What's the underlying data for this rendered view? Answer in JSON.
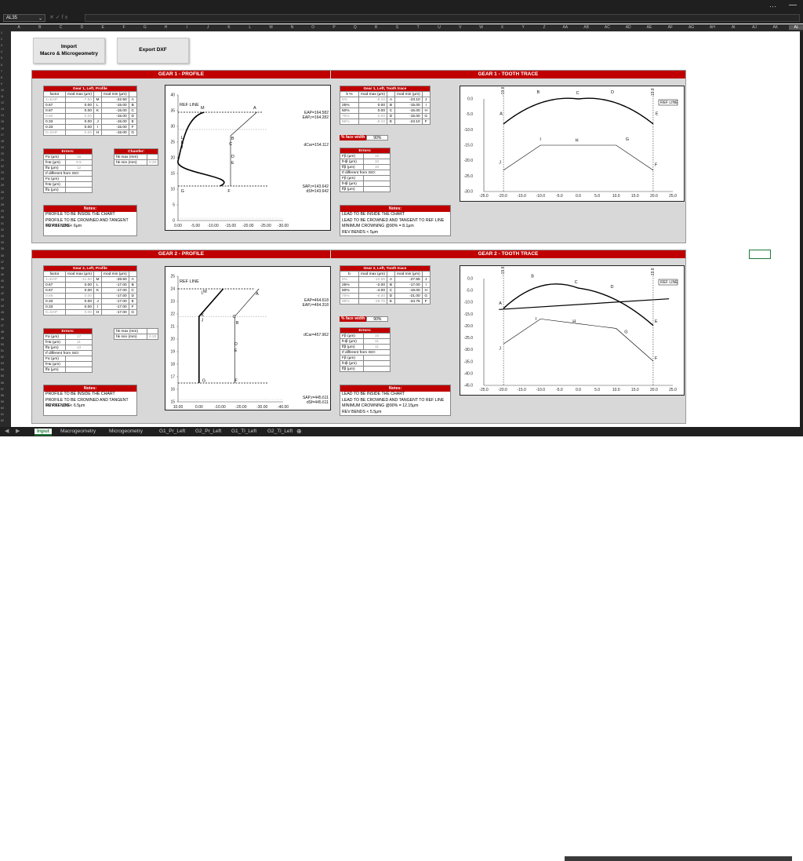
{
  "excel": {
    "name_box": "AL35",
    "title_dots": "···",
    "title_min": "—",
    "columns": [
      "A",
      "B",
      "C",
      "D",
      "E",
      "F",
      "G",
      "H",
      "I",
      "J",
      "K",
      "L",
      "M",
      "N",
      "O",
      "P",
      "Q",
      "R",
      "S",
      "T",
      "U",
      "V",
      "W",
      "X",
      "Y",
      "Z",
      "AA",
      "AB",
      "AC",
      "AD",
      "AE",
      "AF",
      "AG",
      "AH",
      "AI",
      "AJ",
      "AK",
      "AL",
      "AM"
    ],
    "tabs": [
      "Input",
      "Macrogeometry",
      "Microgeometry",
      "G1_Pr_Left",
      "G2_Pr_Left",
      "G1_Tl_Left",
      "G2_Tl_Left"
    ],
    "active_tab": "Input",
    "tab_add": "⊕"
  },
  "buttons": {
    "import": "Import\nMacro & Microgeometry",
    "export": "Export DXF"
  },
  "gear1": {
    "profile_title": "GEAR 1 - PROFILE",
    "trace_title": "GEAR 1 - TOOTH TRACE",
    "profile_table": {
      "title": "Gear 1, Left, Profile",
      "headers": [
        "factor",
        "mod max (μm)",
        "",
        "mod min (μm)",
        ""
      ],
      "rows": [
        [
          "1=EAP",
          "-7.50",
          "M",
          "-22.50",
          "A"
        ],
        [
          "0.67",
          "0.00",
          "L",
          "-15.00",
          "B"
        ],
        [
          "0.67",
          "0.00",
          "K",
          "-15.00",
          "C"
        ],
        [
          "0.60",
          "0.00",
          "",
          "-15.00",
          "D"
        ],
        [
          "0.33",
          "0.00",
          "J",
          "-15.00",
          "E"
        ],
        [
          "0.33",
          "0.00",
          "I",
          "-15.00",
          "F"
        ],
        [
          "0=SAP",
          "0.00",
          "H",
          "-15.00",
          "G"
        ]
      ]
    },
    "errors": {
      "title": "Errors:",
      "rows": [
        [
          "Fα (μm)",
          "15"
        ],
        [
          "fHα (μm)",
          "9.5"
        ],
        [
          "ffα (μm)",
          "12"
        ]
      ],
      "iso": "If different from ISO:",
      "iso_rows": [
        "Fα (μm)",
        "fHα (μm)",
        "ffα (μm)"
      ]
    },
    "chamfer": {
      "title": "Chamfer:",
      "rows": [
        [
          "hk max (mm)",
          ""
        ],
        [
          "hk min (mm)",
          "0.20"
        ]
      ]
    },
    "notes": {
      "title": "Notes:",
      "lines": [
        "PROFILE TO BE INSIDE THE CHART",
        "PROFILE TO BE CROWNED AND TANGENT TO REF LINE",
        "REV BENDS < 6μm"
      ]
    },
    "trace_table": {
      "title": "Gear 1, Left, Tooth trace",
      "headers": [
        "b %",
        "mod max (μm)",
        "",
        "mod min (μm)",
        ""
      ],
      "rows": [
        [
          "5%",
          "-8.10",
          "A",
          "-23.10",
          "J"
        ],
        [
          "25%",
          "0.00",
          "B",
          "-15.00",
          "I"
        ],
        [
          "50%",
          "0.00",
          "C",
          "-15.00",
          "H"
        ],
        [
          "75%",
          "0.00",
          "D",
          "-15.00",
          "G"
        ],
        [
          "95%",
          "-8.10",
          "E",
          "-23.10",
          "F"
        ]
      ]
    },
    "face_width": {
      "label": "% face width",
      "value": "90%"
    },
    "trace_errors": {
      "title": "Errors:",
      "rows": [
        [
          "Fβ (μm)",
          "15"
        ],
        [
          "fHβ (μm)",
          "10"
        ],
        [
          "ffβ (μm)",
          "10"
        ]
      ],
      "iso": "If different from ISO:",
      "iso_rows": [
        "Fβ (μm)",
        "fHβ (μm)",
        "ffβ (μm)"
      ]
    },
    "trace_notes": {
      "title": "Notes:",
      "lines": [
        "LEAD TO BE INSIDE THE CHART",
        "LEAD TO BE CROWNED AND TANGENT TO REF LINE",
        "MINIMUM CROWNING @90% = 8.1μm",
        "REV BENDS < 5μm"
      ]
    },
    "profile_chart": {
      "yticks": [
        "40",
        "35",
        "30",
        "25",
        "20",
        "15",
        "10",
        "5",
        "0"
      ],
      "xticks": [
        "0.00",
        "-5.00",
        "-10.00",
        "-15.00",
        "-20.00",
        "-25.00",
        "-30.00"
      ],
      "ref_line": "REF LINE",
      "point_labels": [
        "M",
        "A",
        "B",
        "C",
        "D",
        "E",
        "F",
        "G",
        "H",
        "I",
        "J",
        "K",
        "L"
      ],
      "annotations": [
        "EAP=164.582",
        "EAP,r=164.282",
        "dCar=154.112",
        "SAP,r=143.642",
        "dSf=143.642"
      ]
    },
    "trace_chart": {
      "yticks": [
        "0.0",
        "-5.0",
        "-10.0",
        "-15.0",
        "-20.0",
        "-25.0",
        "-30.0"
      ],
      "xticks": [
        "-25.0",
        "-20.0",
        "-15.0",
        "-10.0",
        "-5.0",
        "0.0",
        "5.0",
        "10.0",
        "15.0",
        "20.0",
        "25.0"
      ],
      "ref_line": "REF LINE",
      "point_labels": [
        "A",
        "B",
        "C",
        "D",
        "E",
        "F",
        "G",
        "H",
        "I",
        "J"
      ],
      "edge_labels": [
        "-19.8",
        "19.8"
      ]
    }
  },
  "gear2": {
    "profile_title": "GEAR 2 - PROFILE",
    "trace_title": "GEAR 2 - TOOTH TRACE",
    "profile_table": {
      "title": "Gear 2, Left, Profile",
      "headers": [
        "factor",
        "mod max (μm)",
        "",
        "mod min (μm)",
        ""
      ],
      "rows": [
        [
          "1=EAP",
          "-11.50",
          "M",
          "-28.50",
          "A"
        ],
        [
          "0.67",
          "0.00",
          "L",
          "-17.00",
          "B"
        ],
        [
          "0.67",
          "0.00",
          "K",
          "-17.00",
          "C"
        ],
        [
          "0.69",
          "0.00",
          "",
          "-17.00",
          "D"
        ],
        [
          "0.33",
          "0.00",
          "J",
          "-17.00",
          "E"
        ],
        [
          "0.33",
          "0.00",
          "I",
          "-17.00",
          "F"
        ],
        [
          "0=SAP",
          "0.00",
          "H",
          "-17.00",
          "G"
        ]
      ]
    },
    "errors": {
      "title": "Errors:",
      "rows": [
        [
          "Fα (μm)",
          "17"
        ],
        [
          "fHα (μm)",
          "11"
        ],
        [
          "ffα (μm)",
          "13"
        ]
      ],
      "iso": "If different from ISO:",
      "iso_rows": [
        "Fα (μm)",
        "fHα (μm)",
        "ffα (μm)"
      ]
    },
    "chamfer": {
      "title": "",
      "rows": [
        [
          "hk max (mm)",
          ""
        ],
        [
          "hk min (mm)",
          "0.20"
        ]
      ]
    },
    "notes": {
      "title": "Notes:",
      "lines": [
        "PROFILE TO BE INSIDE THE CHART",
        "PROFILE TO BE CROWNED AND TANGENT TO REF LINE",
        "REV BENDS < 6.5μm"
      ]
    },
    "trace_table": {
      "title": "Gear 2, Left, Tooth trace",
      "headers": [
        "b",
        "mod max (μm)",
        "",
        "mod min (μm)",
        ""
      ],
      "rows": [
        [
          "5%",
          "-12.55",
          "A",
          "-27.55",
          "J"
        ],
        [
          "25%",
          "-2.00",
          "B",
          "-17.00",
          "I"
        ],
        [
          "50%",
          "-4.00",
          "C",
          "-19.00",
          "H"
        ],
        [
          "75%",
          "-6.00",
          "D",
          "-21.00",
          "G"
        ],
        [
          "95%",
          "-19.75",
          "E",
          "-34.75",
          "F"
        ]
      ]
    },
    "face_width": {
      "label": "% face width",
      "value": "90%"
    },
    "trace_errors": {
      "title": "Errors:",
      "rows": [
        [
          "Fβ (μm)",
          "15"
        ],
        [
          "fHβ (μm)",
          "11"
        ],
        [
          "ffβ (μm)",
          "11"
        ]
      ],
      "iso": "If different from ISO:",
      "iso_rows": [
        "Fβ (μm)",
        "fHβ (μm)",
        "ffβ (μm)"
      ]
    },
    "trace_notes": {
      "title": "Notes:",
      "lines": [
        "LEAD TO BE INSIDE THE CHART",
        "LEAD TO BE CROWNED AND TANGENT TO REF LINE",
        "MINIMUM CROWNING @90% = 12.15μm",
        "REV BENDS < 5.5μm"
      ]
    },
    "profile_chart": {
      "yticks": [
        "25",
        "24",
        "23",
        "22",
        "21",
        "20",
        "19",
        "18",
        "17",
        "16",
        "15"
      ],
      "xticks": [
        "10.00",
        "0.00",
        "-10.00",
        "-20.00",
        "-30.00",
        "-40.00"
      ],
      "ref_line": "REF LINE",
      "point_labels": [
        "M",
        "A",
        "B",
        "C",
        "D",
        "E",
        "F",
        "G",
        "H",
        "I",
        "J",
        "K",
        "L"
      ],
      "annotations": [
        "EAP=464.618",
        "EAP,r=464.318",
        "dCar=457.962",
        "SAP,r=445.611",
        "dSf=445.611"
      ]
    },
    "trace_chart": {
      "yticks": [
        "0.0",
        "-5.0",
        "-10.0",
        "-15.0",
        "-20.0",
        "-25.0",
        "-30.0",
        "-35.0",
        "-40.0",
        "-45.0"
      ],
      "xticks": [
        "-25.0",
        "-20.0",
        "-15.0",
        "-10.0",
        "-5.0",
        "0.0",
        "5.0",
        "10.0",
        "15.0",
        "20.0",
        "25.0"
      ],
      "ref_line": "REF LINE",
      "point_labels": [
        "A",
        "B",
        "C",
        "D",
        "E",
        "F",
        "G",
        "H",
        "I",
        "J"
      ],
      "edge_labels": [
        "-19.8",
        "19.8"
      ]
    }
  },
  "chart_data": [
    {
      "type": "line",
      "name": "Gear 1 profile",
      "xlim": [
        0,
        -30
      ],
      "ylim": [
        0,
        40
      ],
      "series": [
        {
          "name": "max",
          "points": [
            [
              -7.5,
              34.5
            ],
            [
              0,
              31
            ],
            [
              0,
              19
            ],
            [
              -12,
              11
            ]
          ]
        },
        {
          "name": "min",
          "points": [
            [
              -22.5,
              34.5
            ],
            [
              -15,
              27
            ],
            [
              -15,
              11
            ]
          ]
        }
      ]
    },
    {
      "type": "line",
      "name": "Gear 1 tooth trace",
      "xlim": [
        -25,
        25
      ],
      "ylim": [
        -30,
        0
      ],
      "series": [
        {
          "name": "max",
          "x": [
            -19.8,
            -10,
            0,
            10,
            19.8
          ],
          "y": [
            -8.1,
            0,
            0,
            0,
            -8.1
          ]
        },
        {
          "name": "min",
          "x": [
            -19.8,
            -10,
            0,
            10,
            19.8
          ],
          "y": [
            -23.1,
            -15,
            -15,
            -15,
            -23.1
          ]
        }
      ]
    },
    {
      "type": "line",
      "name": "Gear 2 profile",
      "xlim": [
        10,
        -40
      ],
      "ylim": [
        15,
        25
      ],
      "series": [
        {
          "name": "max",
          "points": [
            [
              -11.5,
              24
            ],
            [
              0,
              21.8
            ],
            [
              0,
              16.5
            ]
          ]
        },
        {
          "name": "min",
          "points": [
            [
              -28.5,
              24
            ],
            [
              -17,
              21.8
            ],
            [
              -17,
              16.5
            ]
          ]
        }
      ]
    },
    {
      "type": "line",
      "name": "Gear 2 tooth trace",
      "xlim": [
        -25,
        25
      ],
      "ylim": [
        -45,
        0
      ],
      "series": [
        {
          "name": "max",
          "x": [
            -19.8,
            -10,
            0,
            10,
            19.8
          ],
          "y": [
            -12.55,
            -2,
            -4,
            -6,
            -19.75
          ]
        },
        {
          "name": "min",
          "x": [
            -19.8,
            -10,
            0,
            10,
            19.8
          ],
          "y": [
            -27.55,
            -17,
            -19,
            -21,
            -34.75
          ]
        }
      ]
    }
  ]
}
